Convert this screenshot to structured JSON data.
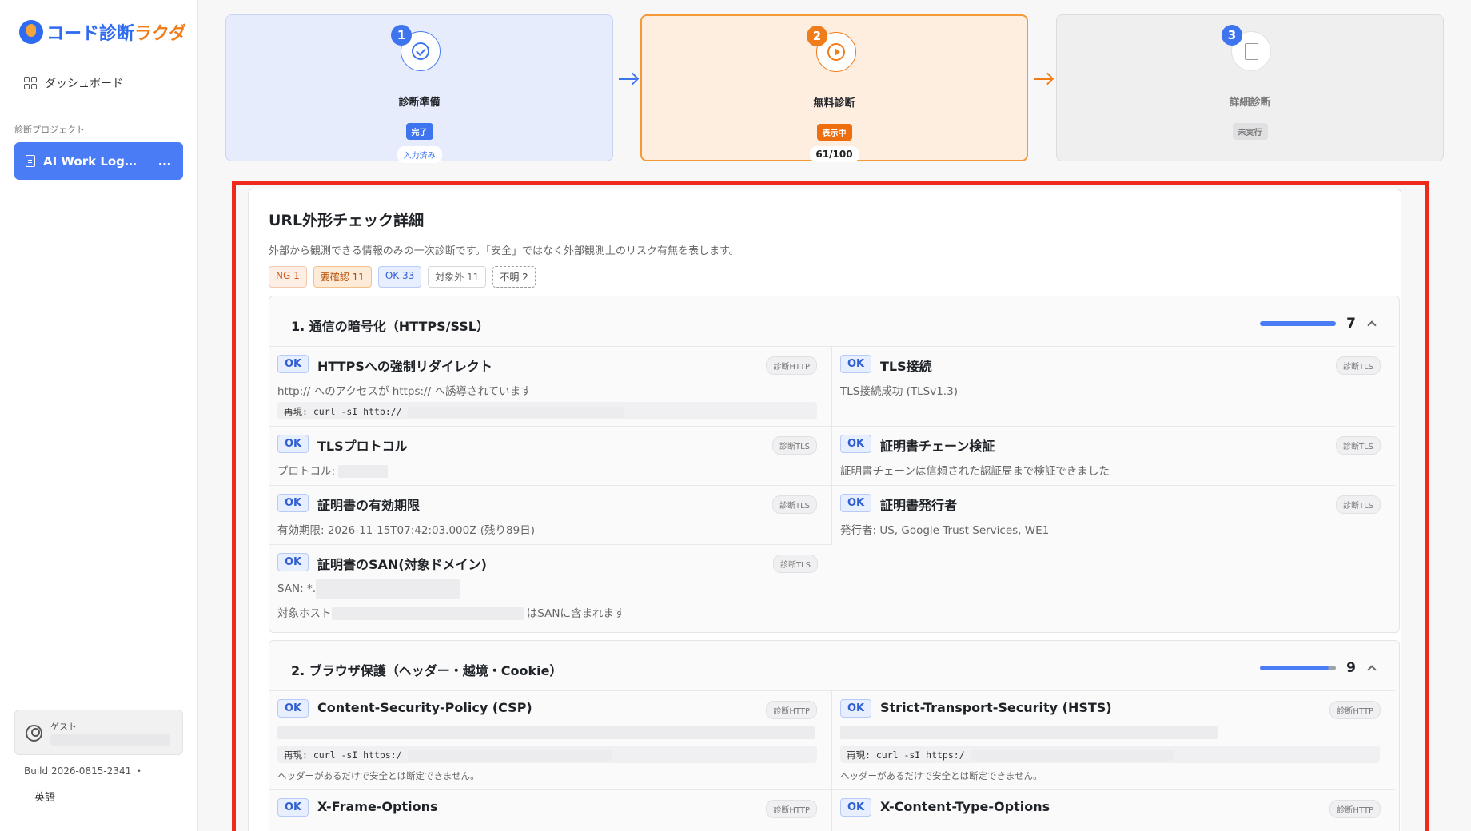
{
  "sidebar": {
    "logo_part1": "コード診断",
    "logo_part2": "ラクダ",
    "dashboard": "ダッシュボード",
    "section_label": "診断プロジェクト",
    "project_label": "AI Work Log…",
    "more": "…",
    "guest_label": "ゲスト",
    "build": "Build 2026-0815-2341 ・",
    "language": "英語"
  },
  "steps": [
    {
      "num": "1",
      "title": "診断準備",
      "badge": "完了",
      "sub": "入力済み"
    },
    {
      "num": "2",
      "title": "無料診断",
      "badge": "表示中",
      "sub": "61/100"
    },
    {
      "num": "3",
      "title": "詳細診断",
      "badge": "未実行"
    }
  ],
  "card": {
    "title": "URL外形チェック詳細",
    "desc": "外部から観測できる情報のみの一次診断です。「安全」ではなく外部観測上のリスク有無を表します。",
    "chips": {
      "ng": "NG 1",
      "check": "要確認 11",
      "ok": "OK 33",
      "na": "対象外 11",
      "unknown": "不明 2"
    }
  },
  "sections": [
    {
      "title": "1. 通信の暗号化（HTTPS/SSL）",
      "count": "7",
      "progress": 1.0,
      "items": [
        {
          "status": "OK",
          "title": "HTTPSへの強制リダイレクト",
          "tag": "診断HTTP",
          "line1": "http:// へのアクセスが https:// へ誘導されています",
          "code": "再現: curl -sI http://"
        },
        {
          "status": "OK",
          "title": "TLS接続",
          "tag": "診断TLS",
          "line1": "TLS接続成功 (TLSv1.3)"
        },
        {
          "status": "OK",
          "title": "TLSプロトコル",
          "tag": "診断TLS",
          "line1": "プロトコル:"
        },
        {
          "status": "OK",
          "title": "証明書チェーン検証",
          "tag": "診断TLS",
          "line1": "証明書チェーンは信頼された認証局まで検証できました"
        },
        {
          "status": "OK",
          "title": "証明書の有効期限",
          "tag": "診断TLS",
          "line1": "有効期限: 2026-11-15T07:42:03.000Z (残り89日)"
        },
        {
          "status": "OK",
          "title": "証明書発行者",
          "tag": "診断TLS",
          "line1": "発行者: US, Google Trust Services, WE1"
        },
        {
          "status": "OK",
          "title": "証明書のSAN(対象ドメイン)",
          "tag": "診断TLS",
          "line1": "SAN: *.",
          "line2a": "対象ホスト",
          "line2b": "はSANに含まれます"
        }
      ]
    },
    {
      "title": "2. ブラウザ保護（ヘッダー・越境・Cookie）",
      "count": "9",
      "progress": 0.9,
      "items": [
        {
          "status": "OK",
          "title": "Content-Security-Policy (CSP)",
          "tag": "診断HTTP",
          "code": "再現: curl -sI https:/",
          "note": "ヘッダーがあるだけで安全とは断定できません。"
        },
        {
          "status": "OK",
          "title": "Strict-Transport-Security (HSTS)",
          "tag": "診断HTTP",
          "code": "再現: curl -sI https:/",
          "note": "ヘッダーがあるだけで安全とは断定できません。"
        },
        {
          "status": "OK",
          "title": "X-Frame-Options",
          "tag": "診断HTTP"
        },
        {
          "status": "OK",
          "title": "X-Content-Type-Options",
          "tag": "診断HTTP"
        }
      ]
    }
  ],
  "colors": {
    "accent_blue": "#3f74ef",
    "accent_orange": "#f07c1a",
    "highlight_red": "#ee2a1c"
  }
}
